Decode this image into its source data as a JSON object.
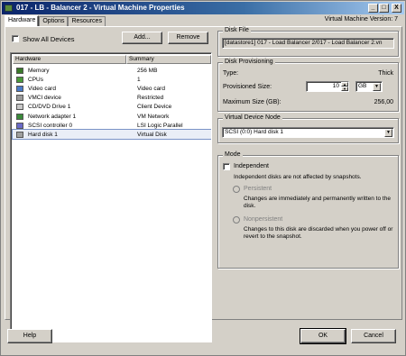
{
  "window": {
    "title": "017 - LB - Balancer 2 - Virtual Machine Properties",
    "minimize": "_",
    "maximize": "□",
    "close": "X"
  },
  "tabs": [
    {
      "label": "Hardware",
      "active": true
    },
    {
      "label": "Options",
      "active": false
    },
    {
      "label": "Resources",
      "active": false
    }
  ],
  "vm_version": "Virtual Machine Version: 7",
  "toolbar": {
    "show_all_devices": "Show All Devices",
    "add_label": "Add...",
    "remove_label": "Remove"
  },
  "hardware_list": {
    "col_hardware": "Hardware",
    "col_summary": "Summary",
    "rows": [
      {
        "name": "Memory",
        "summary": "256 MB",
        "icon": "memory-icon",
        "color": "#3a7a2a"
      },
      {
        "name": "CPUs",
        "summary": "1",
        "icon": "cpu-icon",
        "color": "#4a9a3a"
      },
      {
        "name": "Video card",
        "summary": "Video card",
        "icon": "video-card-icon",
        "color": "#4a7ac8"
      },
      {
        "name": "VMCI device",
        "summary": "Restricted",
        "icon": "vmci-device-icon",
        "color": "#9a9a9a"
      },
      {
        "name": "CD/DVD Drive 1",
        "summary": "Client Device",
        "icon": "cd-dvd-icon",
        "color": "#c8c8c8"
      },
      {
        "name": "Network adapter 1",
        "summary": "VM Network",
        "icon": "network-adapter-icon",
        "color": "#3a8a3a"
      },
      {
        "name": "SCSI controller 0",
        "summary": "LSI Logic Parallel",
        "icon": "scsi-controller-icon",
        "color": "#6a6ac8"
      },
      {
        "name": "Hard disk 1",
        "summary": "Virtual Disk",
        "icon": "hard-disk-icon",
        "color": "#a0a0a0",
        "selected": true
      }
    ]
  },
  "disk_file": {
    "title": "Disk File",
    "value": "[datastore1] 017 - Load Balancer 2/017 - Load Balancer 2.vn"
  },
  "disk_provisioning": {
    "title": "Disk Provisioning",
    "type_label": "Type:",
    "type_value": "Thick",
    "provisioned_label": "Provisioned Size:",
    "provisioned_value": "10",
    "unit": "GB",
    "max_label": "Maximum Size (GB):",
    "max_value": "256,00"
  },
  "virtual_device_node": {
    "title": "Virtual Device Node",
    "value": "SCSI (0:0) Hard disk 1"
  },
  "mode": {
    "title": "Mode",
    "independent_label": "Independent",
    "independent_desc": "Independent disks are not affected by snapshots.",
    "persistent_label": "Persistent",
    "persistent_desc": "Changes are immediately and permanently written to the disk.",
    "nonpersistent_label": "Nonpersistent",
    "nonpersistent_desc": "Changes to this disk are discarded when you power off or revert to the snapshot."
  },
  "footer": {
    "help": "Help",
    "ok": "OK",
    "cancel": "Cancel"
  }
}
